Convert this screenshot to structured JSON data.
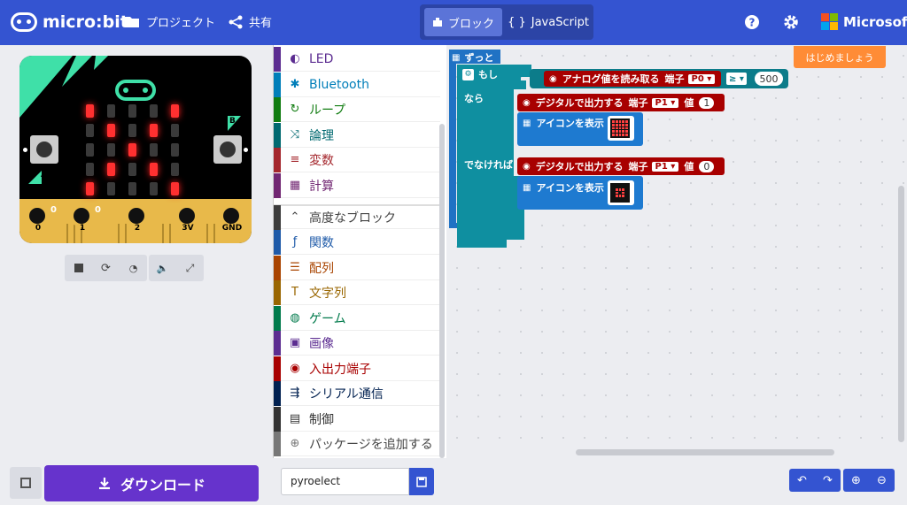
{
  "header": {
    "brand": "micro:bit",
    "projects_label": "プロジェクト",
    "share_label": "共有",
    "tab_blocks": "ブロック",
    "tab_javascript": "JavaScript",
    "microsoft": "Microsoft"
  },
  "simulator": {
    "pin_values": [
      "0",
      "0"
    ],
    "pins": [
      "0",
      "1",
      "2",
      "3V",
      "GND"
    ],
    "button_a": "A",
    "button_b": "B",
    "led_matrix": [
      [
        1,
        0,
        0,
        0,
        1
      ],
      [
        0,
        1,
        0,
        1,
        0
      ],
      [
        0,
        0,
        1,
        0,
        0
      ],
      [
        0,
        1,
        0,
        1,
        0
      ],
      [
        1,
        0,
        0,
        0,
        1
      ]
    ],
    "controls": [
      "stop-icon",
      "restart-icon",
      "slowmo-icon",
      "sound-icon",
      "fullscreen-icon"
    ]
  },
  "toolbox": {
    "categories": [
      {
        "label": "LED",
        "color": "#5c2d91",
        "icon": "toggle-icon"
      },
      {
        "label": "Bluetooth",
        "color": "#007eb9",
        "icon": "bluetooth-icon"
      },
      {
        "label": "ループ",
        "color": "#107c10",
        "icon": "loop-icon"
      },
      {
        "label": "論理",
        "color": "#006970",
        "icon": "shuffle-icon"
      },
      {
        "label": "変数",
        "color": "#a4262c",
        "icon": "list-icon"
      },
      {
        "label": "計算",
        "color": "#712672",
        "icon": "calculator-icon"
      },
      {
        "label": "高度なブロック",
        "color": "#3c3c3c",
        "icon": "chevron-up-icon"
      },
      {
        "label": "関数",
        "color": "#1e5aa8",
        "icon": "function-icon"
      },
      {
        "label": "配列",
        "color": "#a94400",
        "icon": "array-icon"
      },
      {
        "label": "文字列",
        "color": "#996600",
        "icon": "text-icon"
      },
      {
        "label": "ゲーム",
        "color": "#007a4b",
        "icon": "game-icon"
      },
      {
        "label": "画像",
        "color": "#5c2d91",
        "icon": "image-icon"
      },
      {
        "label": "入出力端子",
        "color": "#a80000",
        "icon": "pin-icon"
      },
      {
        "label": "シリアル通信",
        "color": "#002050",
        "icon": "usb-icon"
      },
      {
        "label": "制御",
        "color": "#333333",
        "icon": "control-icon"
      },
      {
        "label": "パッケージを追加する",
        "color": "#777777",
        "icon": "plus-circle-icon"
      }
    ]
  },
  "workspace": {
    "forever": "ずっと",
    "if": "もし",
    "then": "なら",
    "else": "でなければ",
    "analog_read": "アナログ値を読み取る",
    "pin_label": "端子",
    "pin_p0": "P0",
    "operator": "≥",
    "threshold": "500",
    "digital_write": "デジタルで出力する",
    "pin_p1": "P1",
    "value_label": "値",
    "value_high": "1",
    "value_low": "0",
    "show_icon": "アイコンを表示",
    "tutorial": "はじめましょう"
  },
  "footer": {
    "download": "ダウンロード",
    "project_name": "pyroelect"
  }
}
